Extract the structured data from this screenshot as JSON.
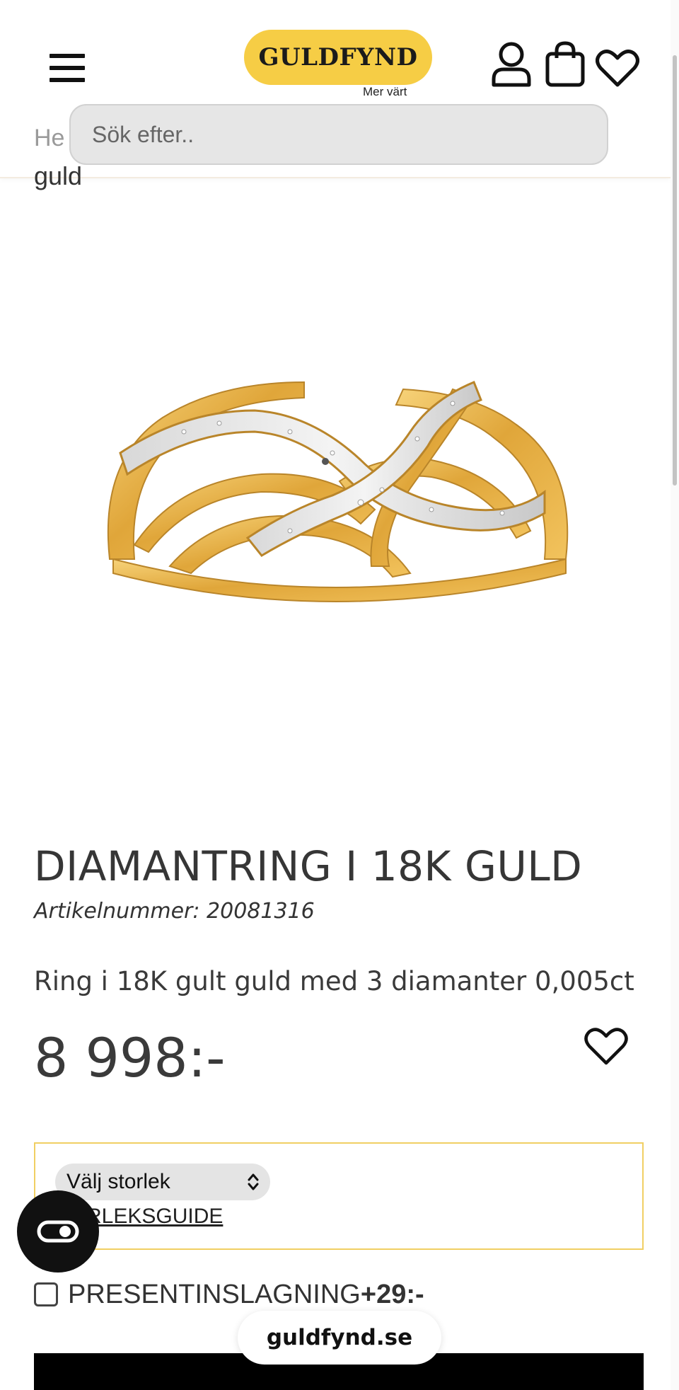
{
  "header": {
    "logo_text": "GULDFYND",
    "logo_tagline": "Mer värt",
    "icons": [
      "menu-icon",
      "user-icon",
      "shopping-bag-icon",
      "heart-icon"
    ],
    "brand_color": "#f6cd45"
  },
  "breadcrumb": {
    "partial": "He",
    "trailing": "guld"
  },
  "search": {
    "placeholder": "Sök efter.."
  },
  "product": {
    "title": "DIAMANTRING I 18K GULD",
    "sku": "Artikelnummer: 20081316",
    "description": "Ring i 18K gult guld med 3 diamanter 0,005ct",
    "price": "8 998:-",
    "size_select": {
      "selected": "Välj storlek"
    },
    "size_guide_label": "RLEKSGUIDE",
    "gift_wrap": {
      "label": "PRESENTINSLAGNING",
      "price": "+29:-",
      "checked": false
    }
  },
  "browser": {
    "url": "guldfynd.se"
  }
}
